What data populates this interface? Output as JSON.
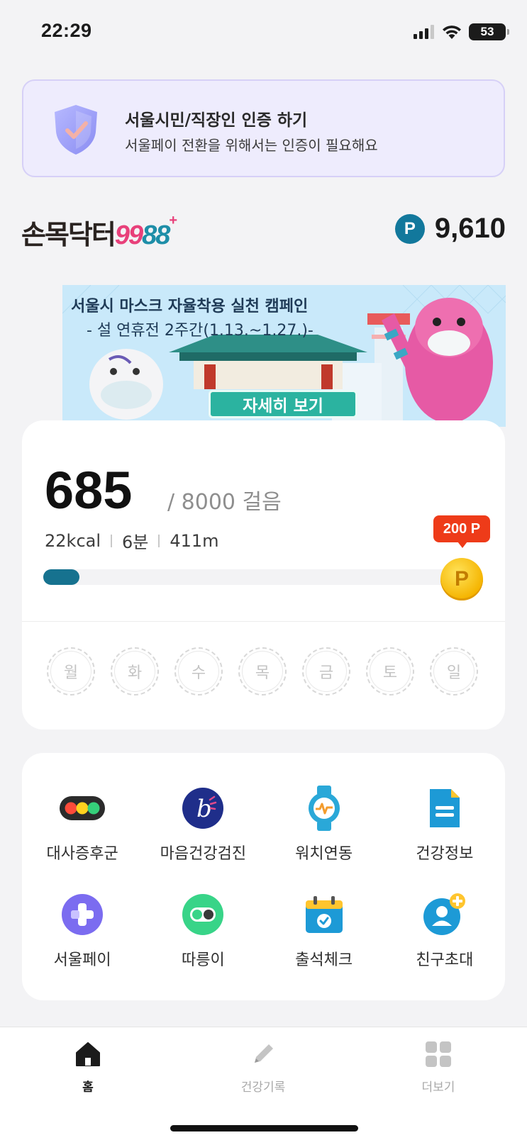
{
  "status": {
    "time": "22:29",
    "battery": "53"
  },
  "auth": {
    "title": "서울시민/직장인 인증 하기",
    "subtitle": "서울페이 전환을 위해서는 인증이 필요해요"
  },
  "brand": {
    "name_main": "손목닥터",
    "name_99": "99",
    "name_88": "88",
    "name_plus": "+"
  },
  "points": {
    "badge": "P",
    "value": "9,610"
  },
  "banner": {
    "title": "서울시 마스크 자율착용 실천 캠페인",
    "subtitle": "- 설 연휴전 2주간(1.13.~1.27.)-",
    "button_label": "자세히 보기"
  },
  "steps": {
    "count": "685",
    "goal_text": "/ 8000 걸음",
    "progress": 0.086,
    "stats": [
      "22kcal",
      "6분",
      "411m"
    ],
    "reward_label": "200 P",
    "coin_label": "P",
    "days": [
      "월",
      "화",
      "수",
      "목",
      "금",
      "토",
      "일"
    ]
  },
  "menu": {
    "items": [
      {
        "label": "대사증후군",
        "icon": "traffic-light-icon"
      },
      {
        "label": "마음건강검진",
        "icon": "mind-b-icon"
      },
      {
        "label": "워치연동",
        "icon": "watch-icon"
      },
      {
        "label": "건강정보",
        "icon": "document-icon"
      },
      {
        "label": "서울페이",
        "icon": "plus-cross-icon"
      },
      {
        "label": "따릉이",
        "icon": "bike-toggle-icon"
      },
      {
        "label": "출석체크",
        "icon": "calendar-check-icon"
      },
      {
        "label": "친구초대",
        "icon": "person-add-icon"
      }
    ]
  },
  "tabs": [
    {
      "label": "홈",
      "icon": "home-icon",
      "active": true
    },
    {
      "label": "건강기록",
      "icon": "pencil-icon",
      "active": false
    },
    {
      "label": "더보기",
      "icon": "grid-icon",
      "active": false
    }
  ],
  "colors": {
    "accent": "#16728f",
    "reward": "#ee3b19",
    "auth_bg": "#eeecfd"
  }
}
